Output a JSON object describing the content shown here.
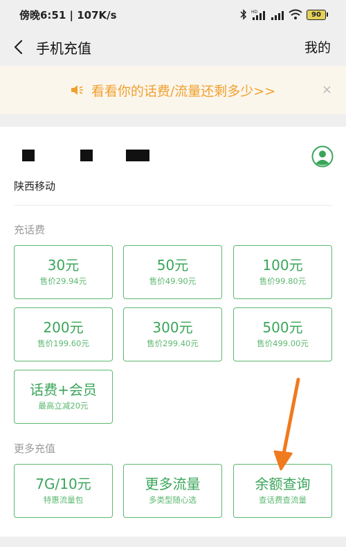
{
  "status_bar": {
    "left": "傍晚6:51 | 107K/s",
    "battery": "90"
  },
  "header": {
    "title": "手机充值",
    "mine": "我的"
  },
  "banner": {
    "text": "看看你的话费/流量还剩多少>>",
    "close": "×"
  },
  "account": {
    "carrier": "陕西移动"
  },
  "recharge": {
    "label": "充话费",
    "tiles": [
      {
        "amount": "30元",
        "price": "售价29.94元"
      },
      {
        "amount": "50元",
        "price": "售价49.90元"
      },
      {
        "amount": "100元",
        "price": "售价99.80元"
      },
      {
        "amount": "200元",
        "price": "售价199.60元"
      },
      {
        "amount": "300元",
        "price": "售价299.40元"
      },
      {
        "amount": "500元",
        "price": "售价499.00元"
      },
      {
        "amount": "话费+会员",
        "price": "最高立减20元"
      }
    ]
  },
  "more": {
    "label": "更多充值",
    "tiles": [
      {
        "title": "7G/10元",
        "sub": "特惠流量包"
      },
      {
        "title": "更多流量",
        "sub": "多类型随心选"
      },
      {
        "title": "余额查询",
        "sub": "查话费查流量"
      }
    ]
  },
  "colors": {
    "accent_green": "#3aa55a",
    "banner_orange": "#f0a030",
    "annotation_arrow": "#f07a1e"
  }
}
